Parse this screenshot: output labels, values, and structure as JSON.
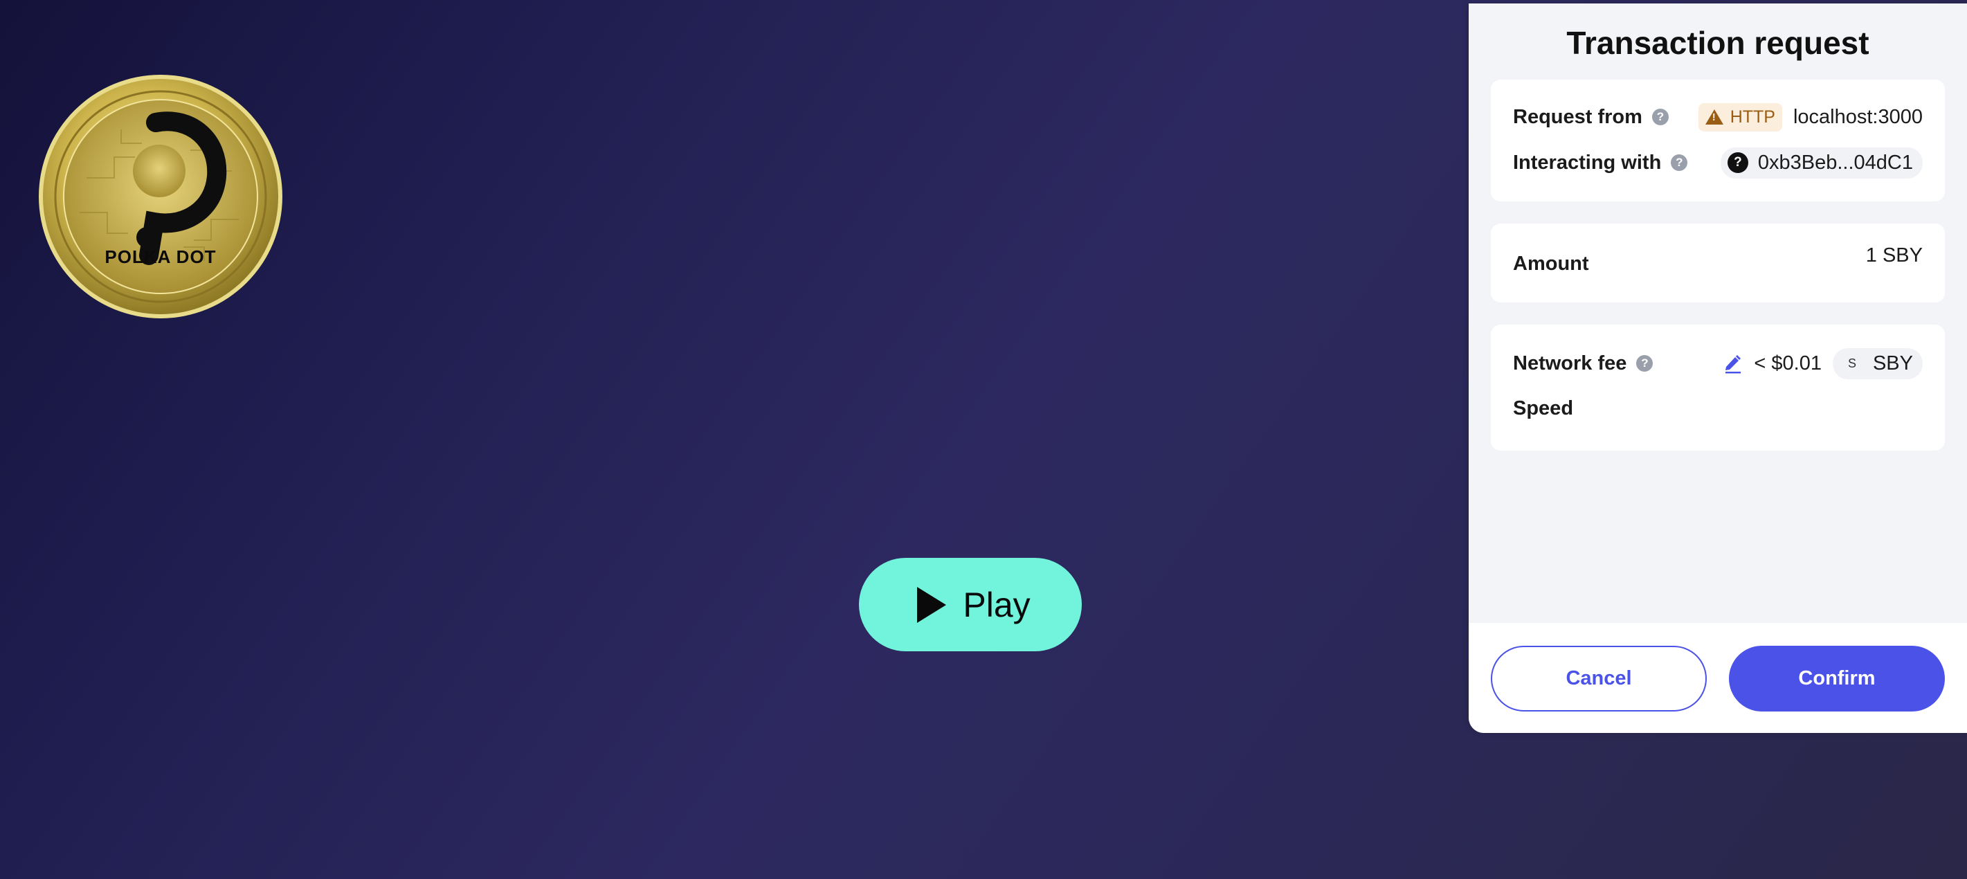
{
  "background": {
    "gradient_colors": [
      "#14123a",
      "#2d2960",
      "#2a2748"
    ]
  },
  "logo": {
    "icon": "polkadot-coin-logo",
    "text": "POLKA DOT",
    "colors": {
      "gold": "#d8c25a",
      "dark": "#0b0b0b"
    }
  },
  "game": {
    "play_label": "Play",
    "play_icon": "play-triangle-icon",
    "button_color": "#72f4dc"
  },
  "wallet": {
    "title": "Transaction request",
    "origin": {
      "request_from_label": "Request from",
      "protocol_badge": "HTTP",
      "host": "localhost:3000",
      "interacting_with_label": "Interacting with",
      "contract_icon": "?",
      "contract_address": "0xb3Beb...04dC1"
    },
    "amount": {
      "label": "Amount",
      "value": "1 SBY"
    },
    "fee": {
      "label": "Network fee",
      "value": "< $0.01",
      "token_icon_letter": "S",
      "token": "SBY",
      "speed_label": "Speed"
    },
    "actions": {
      "cancel_label": "Cancel",
      "confirm_label": "Confirm"
    },
    "colors": {
      "accent": "#4b52e8",
      "warning_text": "#9a5d14",
      "warning_bg": "#fbeedc"
    }
  }
}
